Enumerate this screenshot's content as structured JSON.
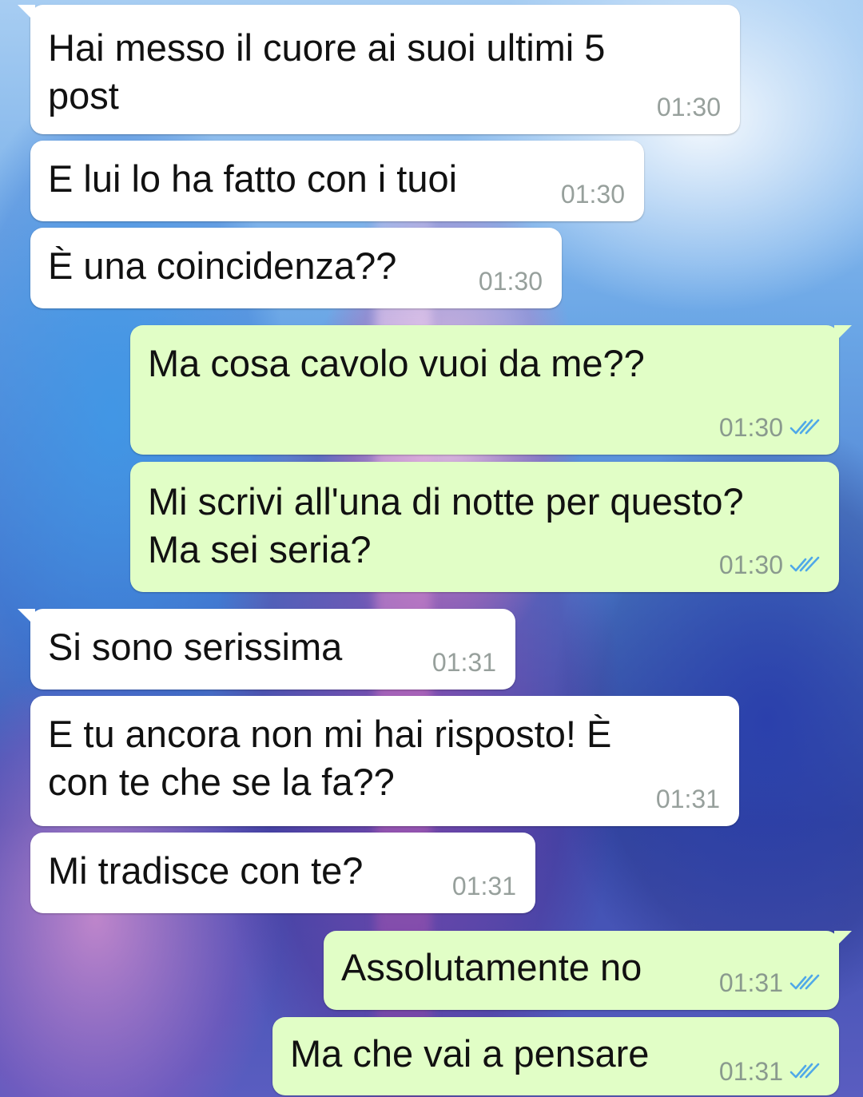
{
  "colors": {
    "incoming_bubble": "#ffffff",
    "outgoing_bubble": "#e1fec6",
    "read_ticks": "#4fa8e8",
    "timestamp": "#8a9a8e"
  },
  "messages": [
    {
      "direction": "incoming",
      "lines": [
        "Hai messo il cuore ai suoi ultimi 5",
        "post"
      ],
      "time": "01:30"
    },
    {
      "direction": "incoming",
      "lines": [
        "E lui lo ha fatto con i tuoi"
      ],
      "time": "01:30"
    },
    {
      "direction": "incoming",
      "lines": [
        "È una coincidenza??"
      ],
      "time": "01:30"
    },
    {
      "direction": "outgoing",
      "lines": [
        "Ma cosa cavolo vuoi da me??"
      ],
      "time": "01:30",
      "status_icon": "double-check-read-icon"
    },
    {
      "direction": "outgoing",
      "lines": [
        "Mi scrivi all'una di notte per questo?",
        "Ma sei seria?"
      ],
      "time": "01:30",
      "status_icon": "double-check-read-icon"
    },
    {
      "direction": "incoming",
      "lines": [
        "Si sono serissima"
      ],
      "time": "01:31"
    },
    {
      "direction": "incoming",
      "lines": [
        "E tu ancora non mi hai risposto! È",
        "con te che se la fa??"
      ],
      "time": "01:31"
    },
    {
      "direction": "incoming",
      "lines": [
        "Mi tradisce con te?"
      ],
      "time": "01:31"
    },
    {
      "direction": "outgoing",
      "lines": [
        "Assolutamente no"
      ],
      "time": "01:31",
      "status_icon": "double-check-read-icon"
    },
    {
      "direction": "outgoing",
      "lines": [
        "Ma che vai a pensare"
      ],
      "time": "01:31",
      "status_icon": "double-check-read-icon"
    }
  ]
}
